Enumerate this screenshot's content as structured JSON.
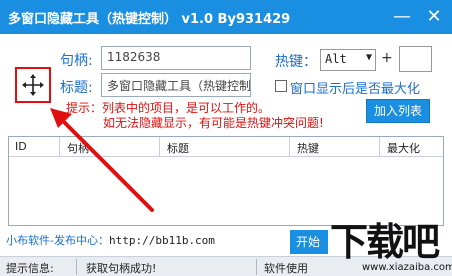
{
  "window": {
    "title": "多窗口隐藏工具（热键控制） v1.0 By931429",
    "minimize_glyph": "—",
    "close_glyph": "✕"
  },
  "form": {
    "handle_label": "句柄:",
    "handle_value": "1182638",
    "title_label": "标题:",
    "title_value": "多窗口隐藏工具（热键控制",
    "hotkey_label": "热键：",
    "hotkey_modifier": "Alt",
    "plus": "+",
    "hotkey_key": "",
    "maximize_checkbox_label": "窗口显示后是否最大化",
    "add_button": "加入列表"
  },
  "hints": {
    "line1": "提示：列表中的项目，是可以工作的。",
    "line2": "如无法隐藏显示，有可能是热键冲突问题!"
  },
  "table": {
    "columns": [
      "ID",
      "句柄",
      "标题",
      "热键",
      "最大化"
    ],
    "rows": []
  },
  "footer": {
    "link_label": "小布软件-发布中心：",
    "link_url": "http://bb11b.com",
    "start_button": "开始"
  },
  "statusbar": {
    "label": "提示信息:",
    "message": "获取句柄成功!",
    "right": "软件使用"
  },
  "watermark": {
    "brand": "下载吧",
    "url": "www.xiazaiba.com"
  },
  "icons": {
    "move": "crosshair-move-icon",
    "arrow": "red-pointer-arrow"
  },
  "colors": {
    "titlebar": "#1a8ee0",
    "label_blue": "#1b6fd0",
    "hint_red": "#e01010"
  }
}
